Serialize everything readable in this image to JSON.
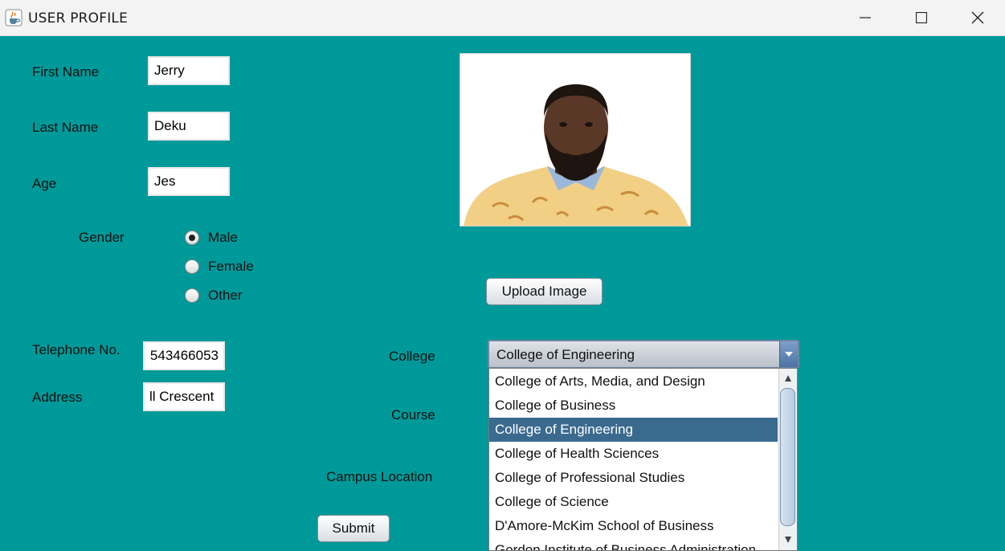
{
  "window": {
    "title": "USER PROFILE"
  },
  "form": {
    "first_name_label": "First Name",
    "first_name_value": "Jerry",
    "last_name_label": "Last Name",
    "last_name_value": "Deku",
    "age_label": "Age",
    "age_value": "Jes",
    "gender_label": "Gender",
    "gender_options": [
      "Male",
      "Female",
      "Other"
    ],
    "gender_selected": "Male",
    "telephone_label": "Telephone No.",
    "telephone_value": "543466053",
    "address_label": "Address",
    "address_value": "ll Crescent",
    "college_label": "College",
    "course_label": "Course",
    "campus_label": "Campus Location",
    "submit_label": "Submit",
    "upload_label": "Upload Image"
  },
  "college_select": {
    "selected": "College of Engineering",
    "options": [
      "College of Arts, Media, and Design",
      "College of Business",
      "College of Engineering",
      "College of Health Sciences",
      "College of Professional Studies",
      "College of Science",
      "D'Amore-McKim School of Business",
      "Gordon Institute of Business Administration"
    ]
  },
  "colors": {
    "background": "#009999",
    "selection": "#3b6a8f"
  },
  "icons": {
    "app": "java-cup-icon",
    "minimize": "minimize-icon",
    "maximize": "maximize-icon",
    "close": "close-icon",
    "dropdown": "chevron-down-icon"
  }
}
